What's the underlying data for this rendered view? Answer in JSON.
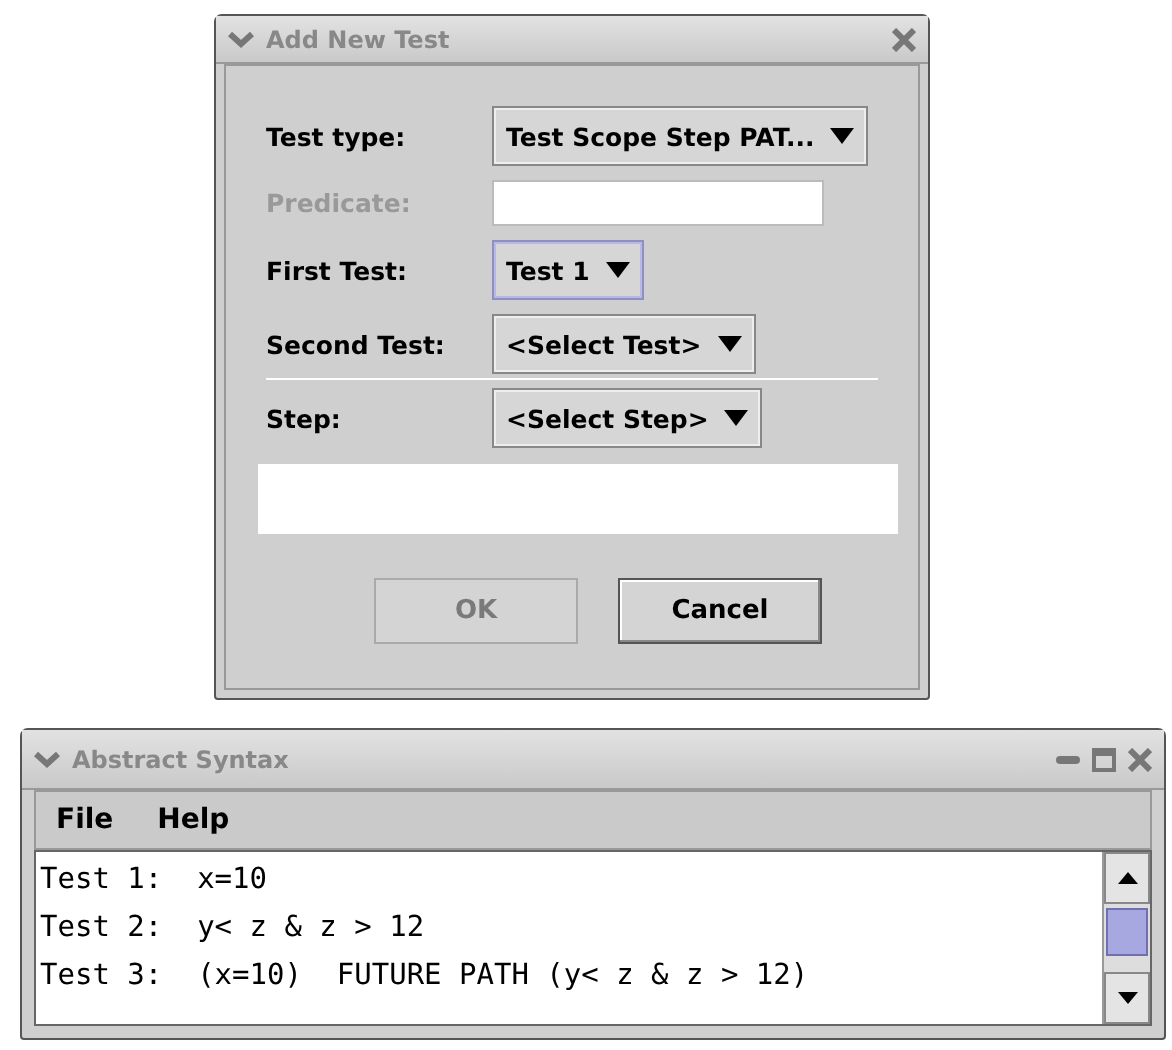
{
  "dialog": {
    "title": "Add New Test",
    "fields": [
      {
        "kind": "combo",
        "label": "Test type:",
        "value": "Test Scope Step PAT...",
        "disabled": false,
        "focused": false
      },
      {
        "kind": "text",
        "label": "Predicate:",
        "disabled": true
      },
      {
        "kind": "combo",
        "label": "First Test:",
        "value": "Test 1",
        "disabled": false,
        "focused": true
      },
      {
        "kind": "combo",
        "label": "Second Test:",
        "value": "<Select Test>",
        "disabled": false,
        "focused": false
      },
      {
        "kind": "separator"
      },
      {
        "kind": "combo",
        "label": "Step:",
        "value": "<Select Step>",
        "disabled": false,
        "focused": false
      },
      {
        "kind": "area"
      }
    ],
    "buttons": [
      {
        "label": "OK",
        "disabled": true
      },
      {
        "label": "Cancel",
        "disabled": false
      }
    ]
  },
  "editor": {
    "title": "Abstract Syntax",
    "menu": [
      "File",
      "Help"
    ],
    "lines": [
      "Test 1:  x=10",
      "Test 2:  y< z & z > 12",
      "Test 3:  (x=10)  FUTURE PATH (y< z & z > 12)"
    ]
  }
}
